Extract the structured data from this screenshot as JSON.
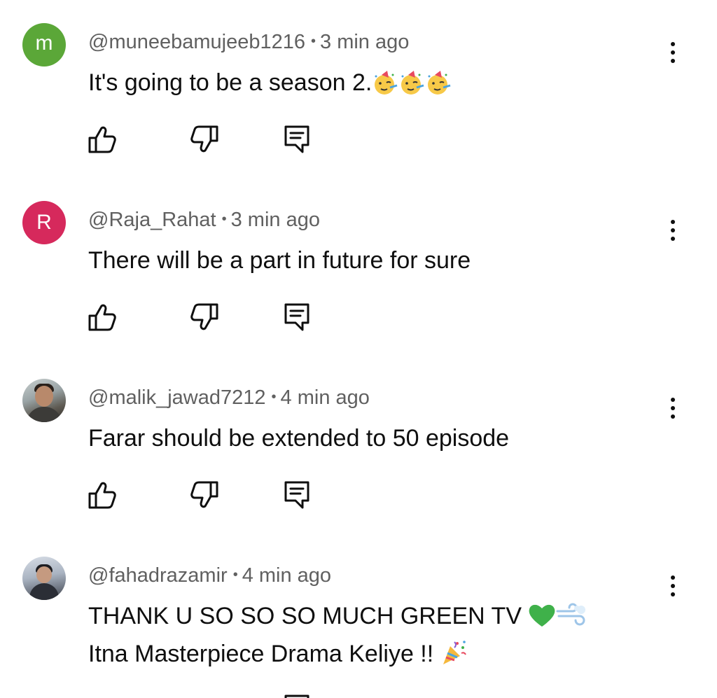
{
  "comments": [
    {
      "username": "@muneebamujeeb1216",
      "time": "3 min ago",
      "text": "It's going to be a season 2.",
      "avatar_letter": "m",
      "avatar_color": "#5ba738",
      "emojis": [
        "partying-face",
        "partying-face",
        "partying-face"
      ]
    },
    {
      "username": "@Raja_Rahat",
      "time": "3 min ago",
      "text": "There will be a part in future for sure",
      "avatar_letter": "R",
      "avatar_color": "#d6295c"
    },
    {
      "username": "@malik_jawad7212",
      "time": "4 min ago",
      "text": "Farar should be extended to 50 episode",
      "avatar_type": "photo"
    },
    {
      "username": "@fahadrazamir",
      "time": "4 min ago",
      "text_line1": "THANK U SO SO SO MUCH GREEN TV ",
      "text_line2": "Itna Masterpiece Drama Keliye !! ",
      "avatar_type": "photo",
      "emojis_line1": [
        "green-heart",
        "dash"
      ],
      "emojis_line2": [
        "party-popper"
      ]
    }
  ],
  "separator": "•",
  "icons": {
    "like": "thumbs-up-icon",
    "dislike": "thumbs-down-icon",
    "reply": "reply-icon",
    "menu": "more-vertical-icon"
  }
}
